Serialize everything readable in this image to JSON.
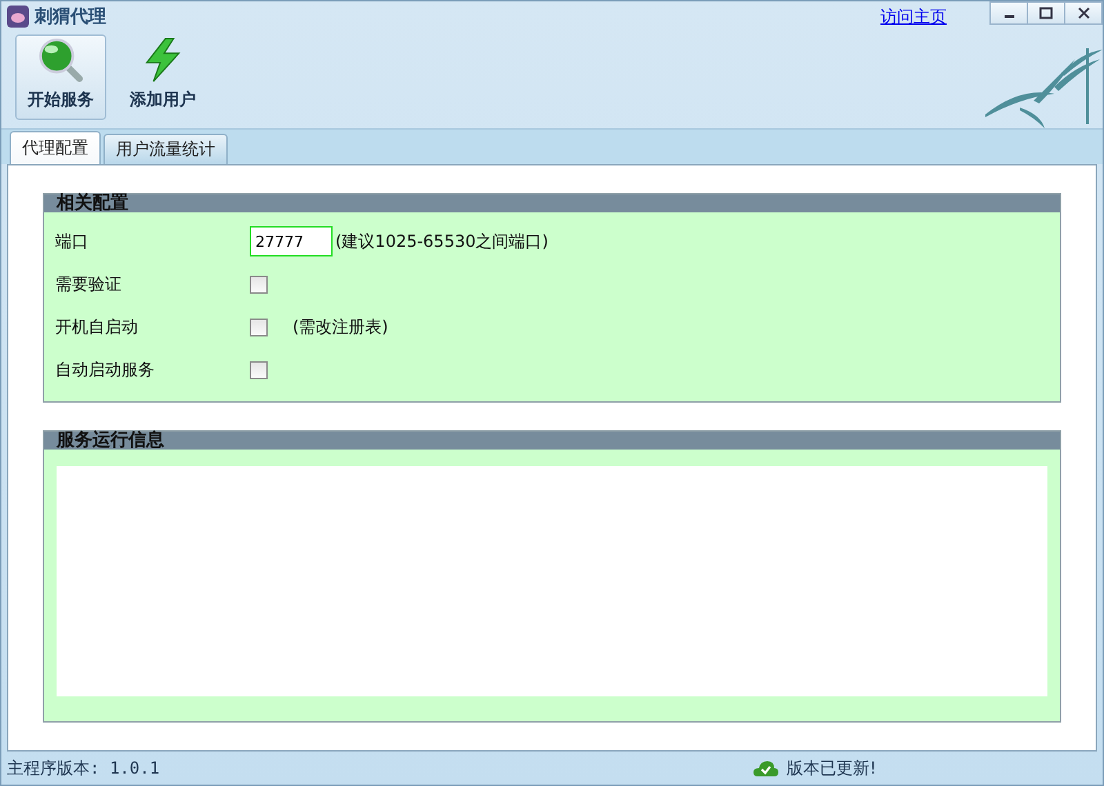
{
  "window": {
    "title": "刺猬代理",
    "link": "访问主页"
  },
  "toolbar": [
    {
      "label": "开始服务",
      "kind": "search",
      "selected": true
    },
    {
      "label": "添加用户",
      "kind": "bolt",
      "selected": false
    }
  ],
  "tabs": [
    {
      "label": "代理配置",
      "selected": true
    },
    {
      "label": "用户流量统计",
      "selected": false
    }
  ],
  "config": {
    "title": "相关配置",
    "rows": [
      {
        "label": "端口",
        "kind": "input",
        "value": "27777",
        "note": "(建议1025-65530之间端口)"
      },
      {
        "label": "需要验证",
        "kind": "checkbox",
        "checked": false
      },
      {
        "label": "开机自启动",
        "kind": "checkbox",
        "checked": false,
        "note": "(需改注册表)"
      },
      {
        "label": "自动启动服务",
        "kind": "checkbox",
        "checked": false
      }
    ]
  },
  "log": {
    "title": "服务运行信息"
  },
  "status_bar": {
    "version": "主程序版本: 1.0.1",
    "update": "版本已更新!"
  }
}
